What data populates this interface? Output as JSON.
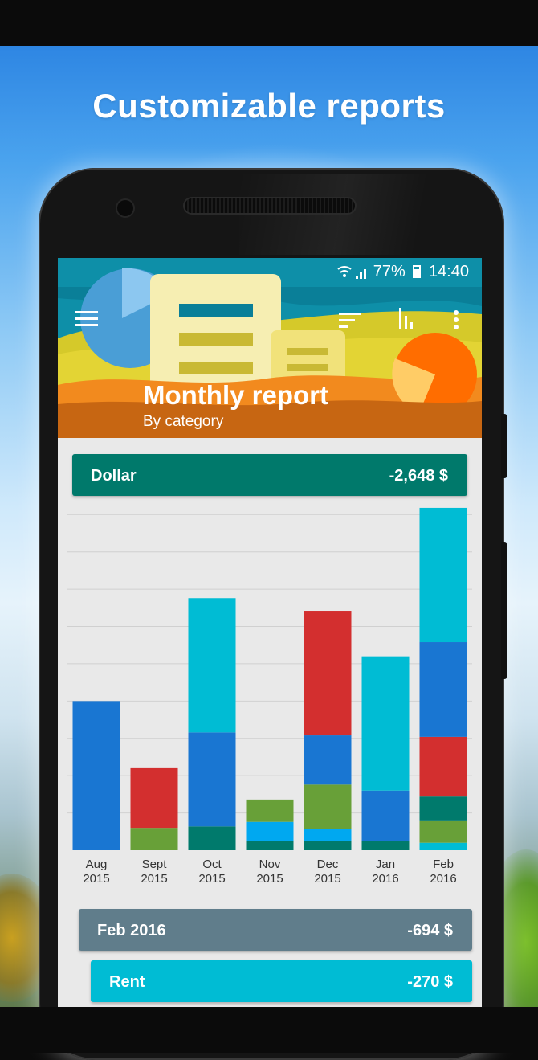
{
  "promo": {
    "headline": "Customizable reports"
  },
  "status_bar": {
    "battery": "77%",
    "time": "14:40"
  },
  "toolbar": {
    "menu_icon": "hamburger-menu-icon",
    "sort_icon": "sort-icon",
    "chart_icon": "bar-chart-icon",
    "more_icon": "overflow-menu-icon"
  },
  "report": {
    "title": "Monthly report",
    "subtitle": "By category"
  },
  "summary": {
    "currency": "Dollar",
    "total": "-2,648 $"
  },
  "colors": {
    "header_teal": "#0e8fa8",
    "accent_green": "#00796b",
    "month_card": "#607d8b",
    "rent_card": "#00bcd4"
  },
  "chart_data": {
    "type": "bar",
    "stacked": true,
    "categories": [
      "Aug\n2015",
      "Sept\n2015",
      "Oct\n2015",
      "Nov\n2015",
      "Dec\n2015",
      "Jan\n2016",
      "Feb\n2016"
    ],
    "category_labels": [
      [
        "Aug",
        "2015"
      ],
      [
        "Sept",
        "2015"
      ],
      [
        "Oct",
        "2015"
      ],
      [
        "Nov",
        "2015"
      ],
      [
        "Dec",
        "2015"
      ],
      [
        "Jan",
        "2016"
      ],
      [
        "Feb",
        "2016"
      ]
    ],
    "grid": true,
    "ylim": [
      0,
      460
    ],
    "series": [
      {
        "color": "#00bcd4",
        "values": [
          0,
          0,
          0,
          0,
          0,
          0,
          10
        ]
      },
      {
        "color": "#007a6c",
        "values": [
          0,
          0,
          32,
          12,
          12,
          12,
          0
        ]
      },
      {
        "color": "#00a8f0",
        "values": [
          0,
          0,
          0,
          26,
          16,
          0,
          0
        ]
      },
      {
        "color": "#68a038",
        "values": [
          0,
          30,
          0,
          30,
          60,
          0,
          30
        ]
      },
      {
        "color": "#007a6c",
        "values": [
          0,
          0,
          0,
          0,
          0,
          0,
          32
        ]
      },
      {
        "color": "#d32f2f",
        "values": [
          0,
          80,
          0,
          0,
          0,
          0,
          80
        ]
      },
      {
        "color": "#1976d2",
        "values": [
          200,
          0,
          126,
          0,
          66,
          68,
          127
        ]
      },
      {
        "color": "#d32f2f",
        "values": [
          0,
          0,
          0,
          0,
          167,
          0,
          0
        ]
      },
      {
        "color": "#00bcd4",
        "values": [
          0,
          0,
          180,
          0,
          0,
          180,
          180
        ]
      }
    ]
  },
  "month_summary": {
    "label": "Feb 2016",
    "total": "-694 $"
  },
  "categories_list": [
    {
      "label": "Rent",
      "amount": "-270 $"
    }
  ]
}
